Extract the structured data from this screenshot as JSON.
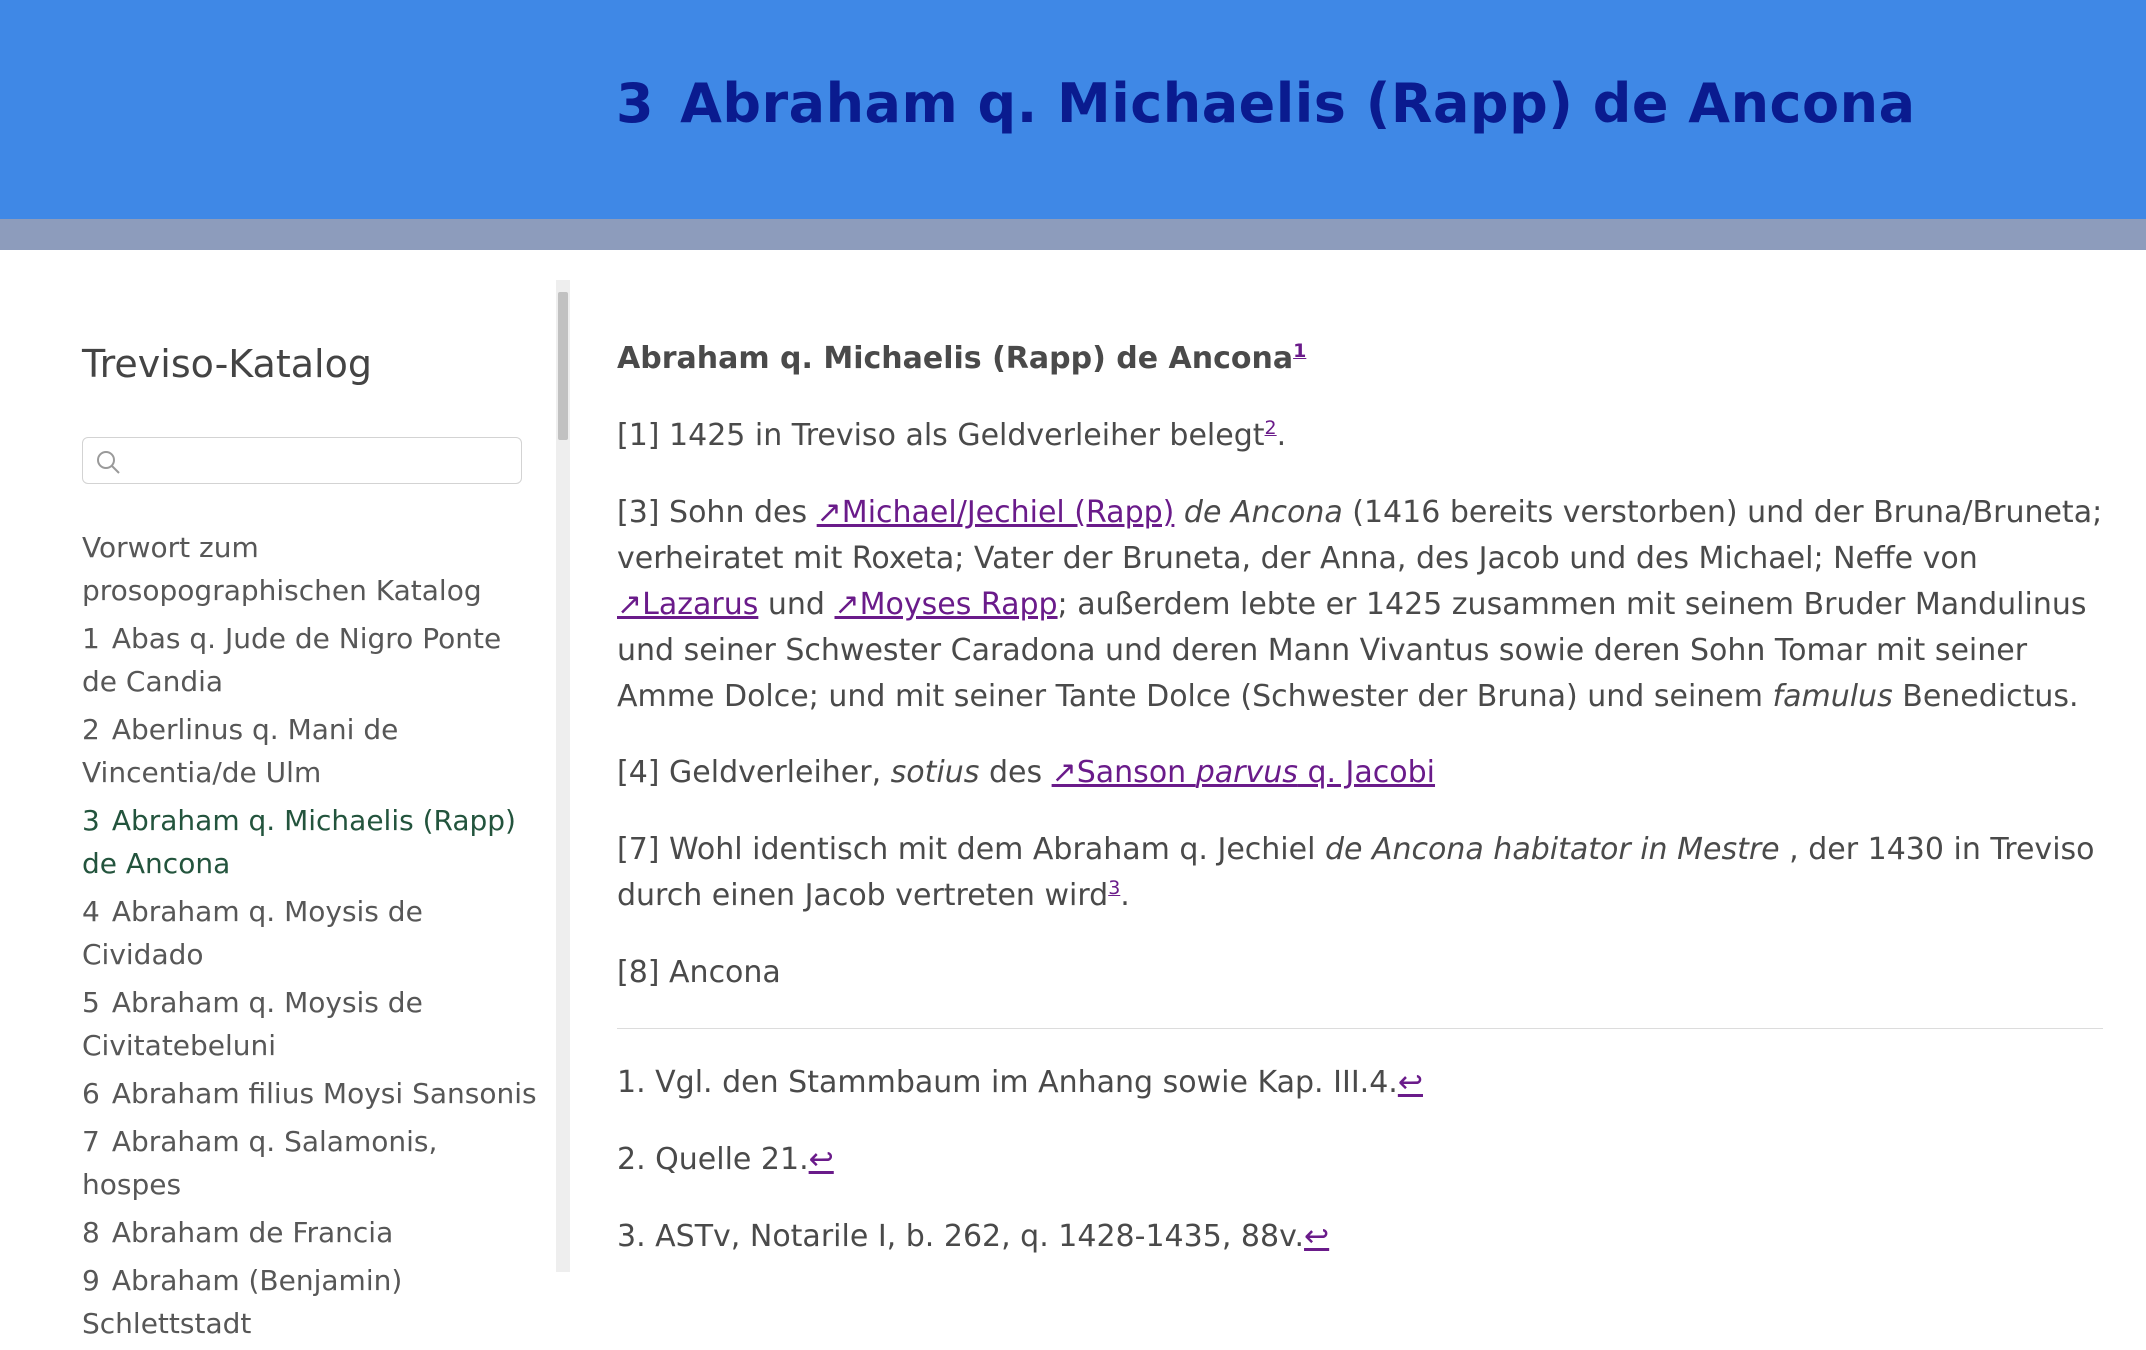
{
  "header": {
    "number": "3",
    "title": "Abraham q. Michaelis (Rapp) de Ancona"
  },
  "sidebar": {
    "title": "Treviso-Katalog",
    "search_placeholder": "",
    "items": [
      {
        "num": "",
        "label": "Vorwort zum prosopographischen Katalog"
      },
      {
        "num": "1",
        "label": "Abas q. Jude de Nigro Ponte de Candia"
      },
      {
        "num": "2",
        "label": "Aberlinus q. Mani de Vincentia/de Ulm"
      },
      {
        "num": "3",
        "label": "Abraham q. Michaelis (Rapp) de Ancona"
      },
      {
        "num": "4",
        "label": "Abraham q. Moysis de Cividado"
      },
      {
        "num": "5",
        "label": "Abraham q. Moysis de Civitatebeluni"
      },
      {
        "num": "6",
        "label": "Abraham filius Moysi Sansonis"
      },
      {
        "num": "7",
        "label": "Abraham q. Salamonis, hospes"
      },
      {
        "num": "8",
        "label": "Abraham de Francia"
      },
      {
        "num": "9",
        "label": "Abraham (Benjamin) Schlettstadt"
      }
    ]
  },
  "entry": {
    "title": "Abraham q. Michaelis (Rapp) de Ancona",
    "title_fn": "1",
    "p1": {
      "text": "[1] 1425 in Treviso als Geldverleiher belegt",
      "fn": "2",
      "end": "."
    },
    "p3": {
      "t1": "[3] Sohn des ",
      "link1": "↗Michael/Jechiel (Rapp)",
      "i1": " de Ancona",
      "t2": " (1416 bereits verstorben) und der Bruna/Bruneta; verheiratet mit Roxeta; Vater der Bruneta, der Anna, des Jacob und des Michael; Neffe von ",
      "link2": "↗Lazarus",
      "t3": " und ",
      "link3": "↗Moyses Rapp",
      "t4": "; außerdem lebte er 1425 zusammen mit seinem Bruder Mandulinus und seiner Schwester Caradona und deren Mann Vivantus sowie deren Sohn Tomar mit seiner Amme Dolce; und mit seiner Tante Dolce (Schwester der Bruna) und seinem ",
      "i2": "famulus",
      "t5": " Benedictus."
    },
    "p4": {
      "t1": "[4] Geldverleiher, ",
      "i1": "sotius",
      "t2": " des ",
      "link_a": "↗Sanson ",
      "link_i": "parvus",
      "link_b": " q. Jacobi"
    },
    "p7": {
      "t1": "[7] Wohl identisch mit dem Abraham q. Jechiel ",
      "i1": "de Ancona habitator in Mestre",
      "t2": " , der 1430 in Treviso durch einen Jacob vertreten wird",
      "fn": "3",
      "end": "."
    },
    "p8": "[8] Ancona"
  },
  "footnotes": [
    {
      "text": "1. Vgl. den Stammbaum im Anhang sowie Kap. III.4.",
      "back": "↩"
    },
    {
      "text": "2. Quelle 21.",
      "back": "↩"
    },
    {
      "text": "3. ASTv, Notarile I, b. 262, q. 1428-1435, 88v.",
      "back": "↩"
    }
  ],
  "colors": {
    "header_bg": "#3f88e6",
    "header_strip": "#8d9cbc",
    "title_color": "#0a1b8f",
    "link_color": "#6a1b8a",
    "active_nav": "#23543d"
  }
}
